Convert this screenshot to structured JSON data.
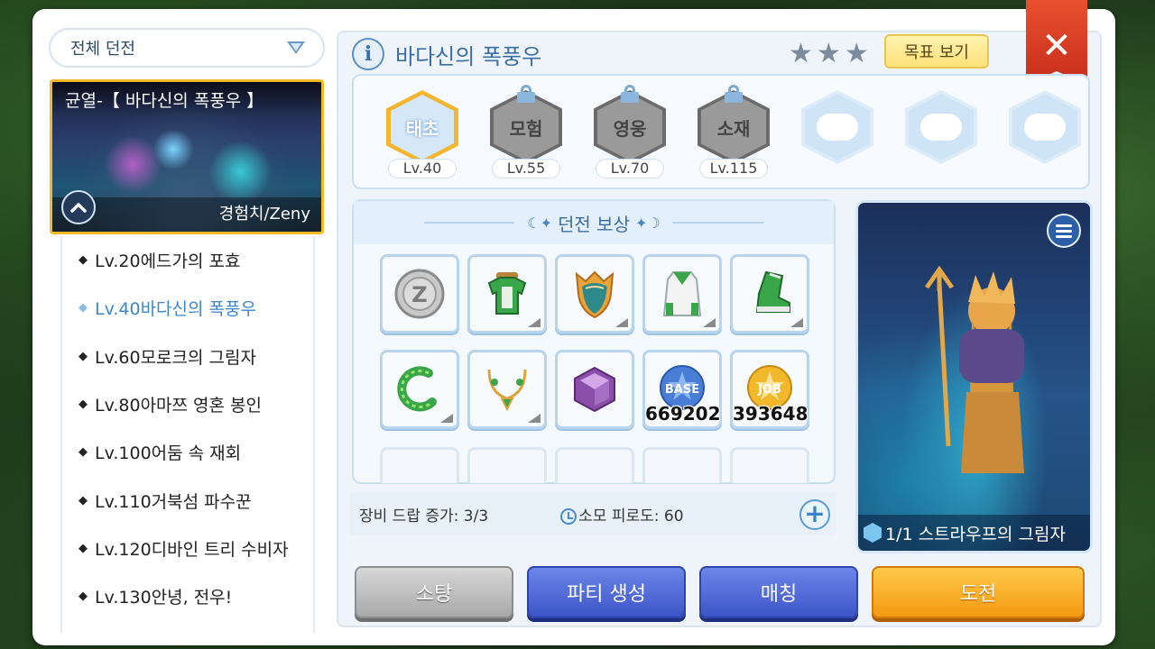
{
  "filter": {
    "selected": "전체 던전"
  },
  "dungeon_card": {
    "title": "균열-【 바다신의 폭풍우 】",
    "reward_type": "경험치/Zeny"
  },
  "dungeon_list": [
    {
      "label": "Lv.20에드가의 포효",
      "active": false
    },
    {
      "label": "Lv.40바다신의 폭풍우",
      "active": true
    },
    {
      "label": "Lv.60모로크의 그림자",
      "active": false
    },
    {
      "label": "Lv.80아마쯔 영혼 봉인",
      "active": false
    },
    {
      "label": "Lv.100어둠 속 재회",
      "active": false
    },
    {
      "label": "Lv.110거북섬 파수꾼",
      "active": false
    },
    {
      "label": "Lv.120디바인 트리 수비자",
      "active": false
    },
    {
      "label": "Lv.130안녕, 전우!",
      "active": false
    }
  ],
  "header": {
    "info_icon": "i",
    "title": "바다신의 폭풍우",
    "goal_button": "목표 보기",
    "close_label": "✕"
  },
  "difficulties": [
    {
      "name": "태초",
      "level": "Lv.40",
      "state": "selected"
    },
    {
      "name": "모험",
      "level": "Lv.55",
      "state": "locked"
    },
    {
      "name": "영웅",
      "level": "Lv.70",
      "state": "locked"
    },
    {
      "name": "소재",
      "level": "Lv.115",
      "state": "locked"
    },
    {
      "name": "",
      "level": "",
      "state": "empty"
    },
    {
      "name": "",
      "level": "",
      "state": "empty"
    },
    {
      "name": "",
      "level": "",
      "state": "empty"
    }
  ],
  "rewards": {
    "header": "던전 보상",
    "items": [
      {
        "icon": "zeny-coin-icon",
        "count": ""
      },
      {
        "icon": "green-armor-icon",
        "count": ""
      },
      {
        "icon": "feather-shield-icon",
        "count": ""
      },
      {
        "icon": "white-cloak-icon",
        "count": ""
      },
      {
        "icon": "green-boots-icon",
        "count": ""
      },
      {
        "icon": "green-ring-icon",
        "count": ""
      },
      {
        "icon": "gold-necklace-icon",
        "count": ""
      },
      {
        "icon": "purple-gem-icon",
        "count": ""
      },
      {
        "icon": "base-exp-icon",
        "label": "BASE",
        "count": "669202"
      },
      {
        "icon": "job-exp-icon",
        "label": "JOB",
        "count": "393648"
      }
    ]
  },
  "info_bar": {
    "equip_drop": "장비 드랍 증가: 3/3",
    "stamina": "소모 피로도: 60"
  },
  "boss": {
    "label": "1/1 스트라우프의 그림자"
  },
  "buttons": {
    "sweep": "소탕",
    "party": "파티 생성",
    "match": "매칭",
    "challenge": "도전"
  },
  "colors": {
    "accent_blue": "#3b6ea5",
    "selected_gold": "#f5b826",
    "challenge_orange": "#f59a12",
    "party_blue": "#3c55c6",
    "close_red": "#d33a22"
  }
}
